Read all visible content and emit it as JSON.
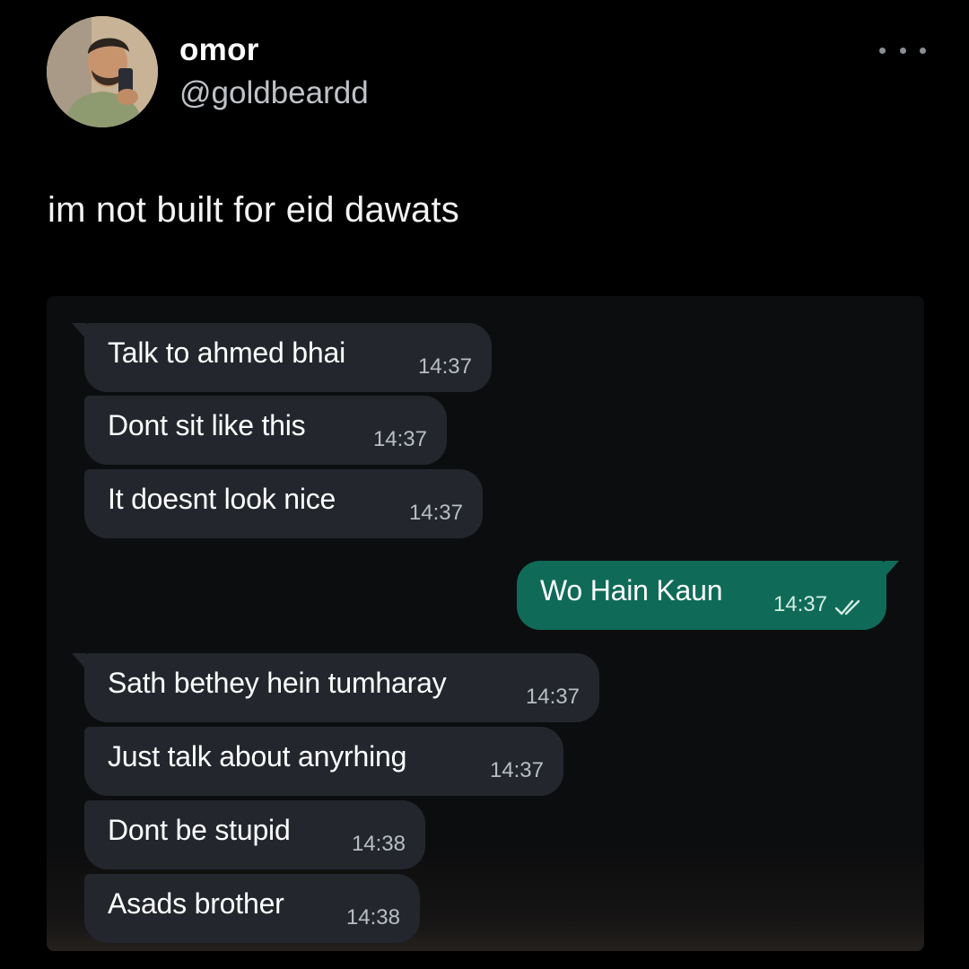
{
  "tweet": {
    "display_name": "omor",
    "handle": "@goldbeardd",
    "text": "im not built for eid dawats",
    "more_icon": "ellipsis-icon"
  },
  "chat": {
    "messages": [
      {
        "direction": "incoming",
        "text": "Talk to ahmed bhai",
        "time": "14:37"
      },
      {
        "direction": "incoming",
        "text": "Dont sit like this",
        "time": "14:37"
      },
      {
        "direction": "incoming",
        "text": "It doesnt look nice",
        "time": "14:37"
      },
      {
        "direction": "outgoing",
        "text": "Wo Hain Kaun",
        "time": "14:37",
        "status_icon": "double-check-icon"
      },
      {
        "direction": "incoming",
        "text": "Sath bethey hein tumharay",
        "time": "14:37"
      },
      {
        "direction": "incoming",
        "text": "Just talk about anyrhing",
        "time": "14:37"
      },
      {
        "direction": "incoming",
        "text": "Dont be stupid",
        "time": "14:38"
      },
      {
        "direction": "incoming",
        "text": "Asads brother",
        "time": "14:38"
      }
    ]
  },
  "colors": {
    "background": "#000000",
    "incoming_bubble": "#23272d",
    "outgoing_bubble": "#0f6b57",
    "handle_text": "#bfc3c8"
  }
}
